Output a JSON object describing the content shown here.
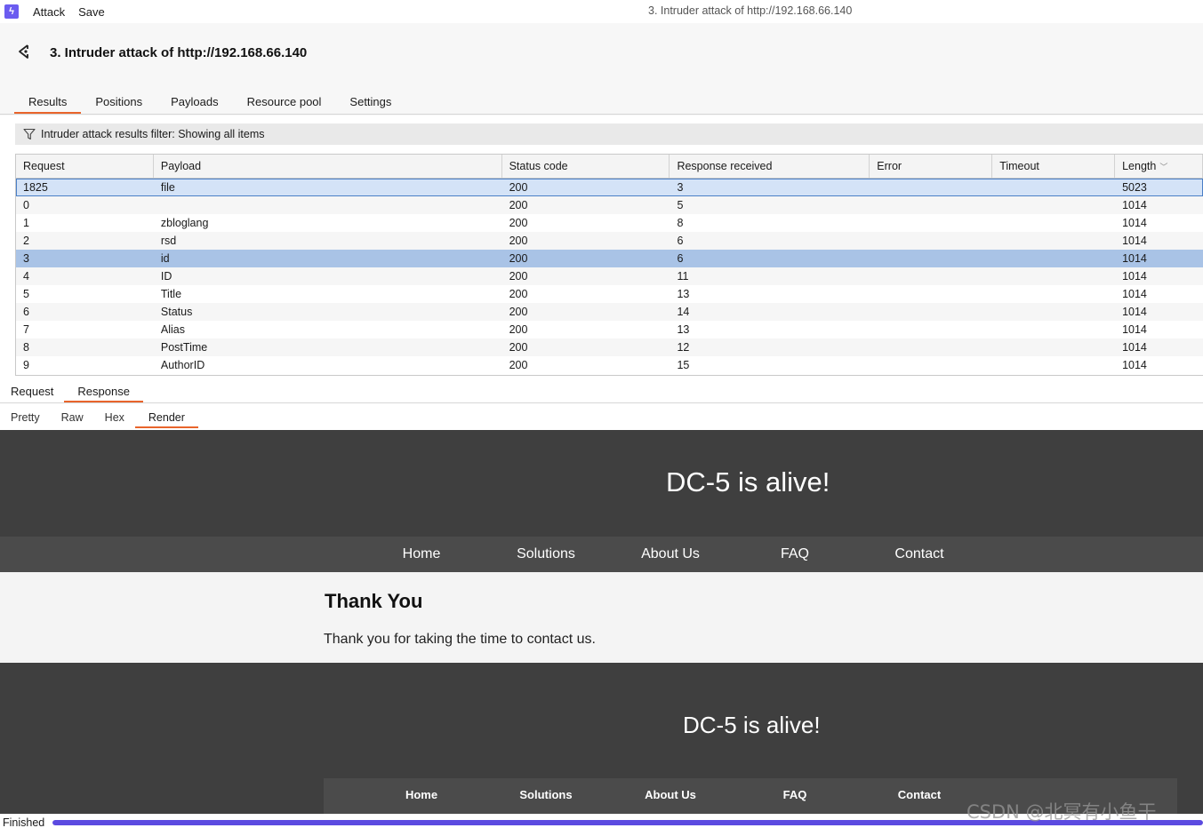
{
  "menubar": {
    "attack_label": "Attack",
    "save_label": "Save",
    "window_title": "3. Intruder attack of http://192.168.66.140"
  },
  "header": {
    "title": "3. Intruder attack of http://192.168.66.140",
    "tabs": [
      {
        "label": "Results",
        "active": true
      },
      {
        "label": "Positions"
      },
      {
        "label": "Payloads"
      },
      {
        "label": "Resource pool"
      },
      {
        "label": "Settings"
      }
    ]
  },
  "filter": {
    "text": "Intruder attack results filter: Showing all items"
  },
  "table": {
    "columns": [
      "Request",
      "Payload",
      "Status code",
      "Response received",
      "Error",
      "Timeout",
      "Length"
    ],
    "rows": [
      [
        "1825",
        "file",
        "200",
        "3",
        "",
        "",
        "5023"
      ],
      [
        "0",
        "",
        "200",
        "5",
        "",
        "",
        "1014"
      ],
      [
        "1",
        "zbloglang",
        "200",
        "8",
        "",
        "",
        "1014"
      ],
      [
        "2",
        "rsd",
        "200",
        "6",
        "",
        "",
        "1014"
      ],
      [
        "3",
        "id",
        "200",
        "6",
        "",
        "",
        "1014"
      ],
      [
        "4",
        "ID",
        "200",
        "11",
        "",
        "",
        "1014"
      ],
      [
        "5",
        "Title",
        "200",
        "13",
        "",
        "",
        "1014"
      ],
      [
        "6",
        "Status",
        "200",
        "14",
        "",
        "",
        "1014"
      ],
      [
        "7",
        "Alias",
        "200",
        "13",
        "",
        "",
        "1014"
      ],
      [
        "8",
        "PostTime",
        "200",
        "12",
        "",
        "",
        "1014"
      ],
      [
        "9",
        "AuthorID",
        "200",
        "15",
        "",
        "",
        "1014"
      ]
    ]
  },
  "rr_tabs": {
    "request": "Request",
    "response": "Response"
  },
  "view_tabs": {
    "pretty": "Pretty",
    "raw": "Raw",
    "hex": "Hex",
    "render": "Render"
  },
  "render": {
    "site_title": "DC-5 is alive!",
    "nav": [
      "Home",
      "Solutions",
      "About Us",
      "FAQ",
      "Contact"
    ],
    "heading": "Thank You",
    "paragraph": "Thank you for taking the time to contact us.",
    "footer_title": "DC-5 is alive!",
    "footer_nav": [
      "Home",
      "Solutions",
      "About Us",
      "FAQ",
      "Contact"
    ]
  },
  "status": {
    "text": "Finished",
    "progress": 1.0
  },
  "watermark": "CSDN @北冥有小鱼干",
  "colors": {
    "accent": "#e8642b",
    "progress": "#5b4ae0",
    "selection": "#a9c3e6"
  }
}
